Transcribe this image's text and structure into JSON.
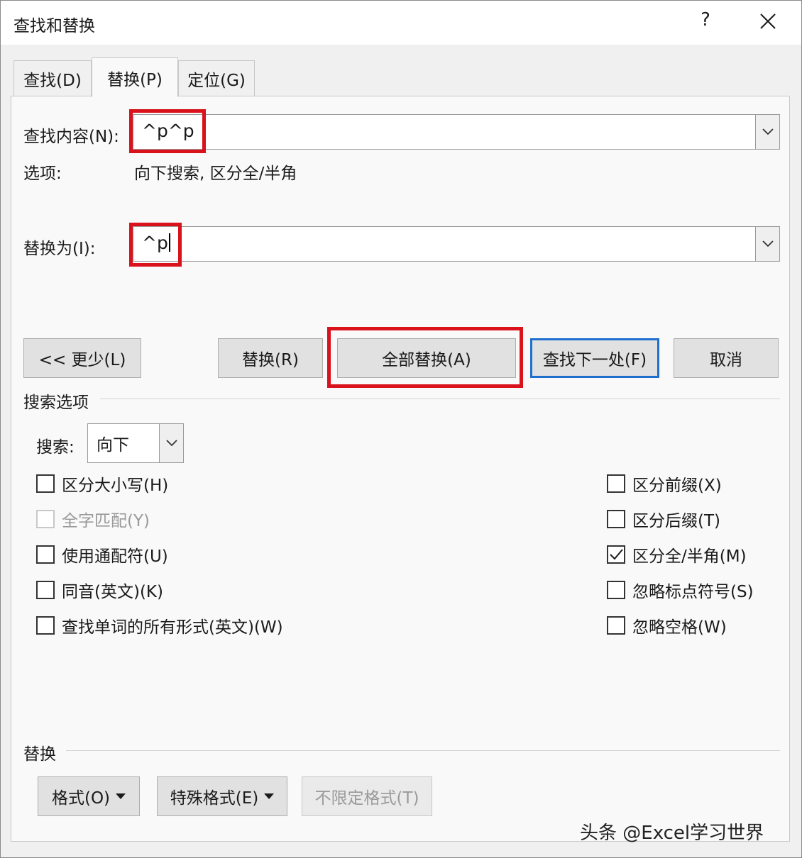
{
  "dialog": {
    "title": "查找和替换",
    "help_label": "?"
  },
  "tabs": [
    {
      "label": "查找(D)",
      "active": false
    },
    {
      "label": "替换(P)",
      "active": true
    },
    {
      "label": "定位(G)",
      "active": false
    }
  ],
  "find": {
    "label": "查找内容(N):",
    "value": "^p^p"
  },
  "options": {
    "label": "选项:",
    "value": "向下搜索, 区分全/半角"
  },
  "replace": {
    "label": "替换为(I):",
    "value": "^p"
  },
  "buttons": {
    "less": "<< 更少(L)",
    "replace": "替换(R)",
    "replace_all": "全部替换(A)",
    "find_next": "查找下一处(F)",
    "cancel": "取消"
  },
  "search_options": {
    "heading": "搜索选项",
    "search_label": "搜索:",
    "search_value": "向下",
    "left": [
      {
        "label": "区分大小写(H)",
        "checked": false,
        "enabled": true
      },
      {
        "label": "全字匹配(Y)",
        "checked": false,
        "enabled": false
      },
      {
        "label": "使用通配符(U)",
        "checked": false,
        "enabled": true
      },
      {
        "label": "同音(英文)(K)",
        "checked": false,
        "enabled": true
      },
      {
        "label": "查找单词的所有形式(英文)(W)",
        "checked": false,
        "enabled": true
      }
    ],
    "right": [
      {
        "label": "区分前缀(X)",
        "checked": false,
        "enabled": true
      },
      {
        "label": "区分后缀(T)",
        "checked": false,
        "enabled": true
      },
      {
        "label": "区分全/半角(M)",
        "checked": true,
        "enabled": true
      },
      {
        "label": "忽略标点符号(S)",
        "checked": false,
        "enabled": true
      },
      {
        "label": "忽略空格(W)",
        "checked": false,
        "enabled": true
      }
    ]
  },
  "replace_section": {
    "heading": "替换",
    "format": "格式(O)",
    "special": "特殊格式(E)",
    "no_format": "不限定格式(T)"
  },
  "watermark": "头条 @Excel学习世界",
  "colors": {
    "highlight": "#d9121c",
    "default_button": "#1f6fd1"
  }
}
